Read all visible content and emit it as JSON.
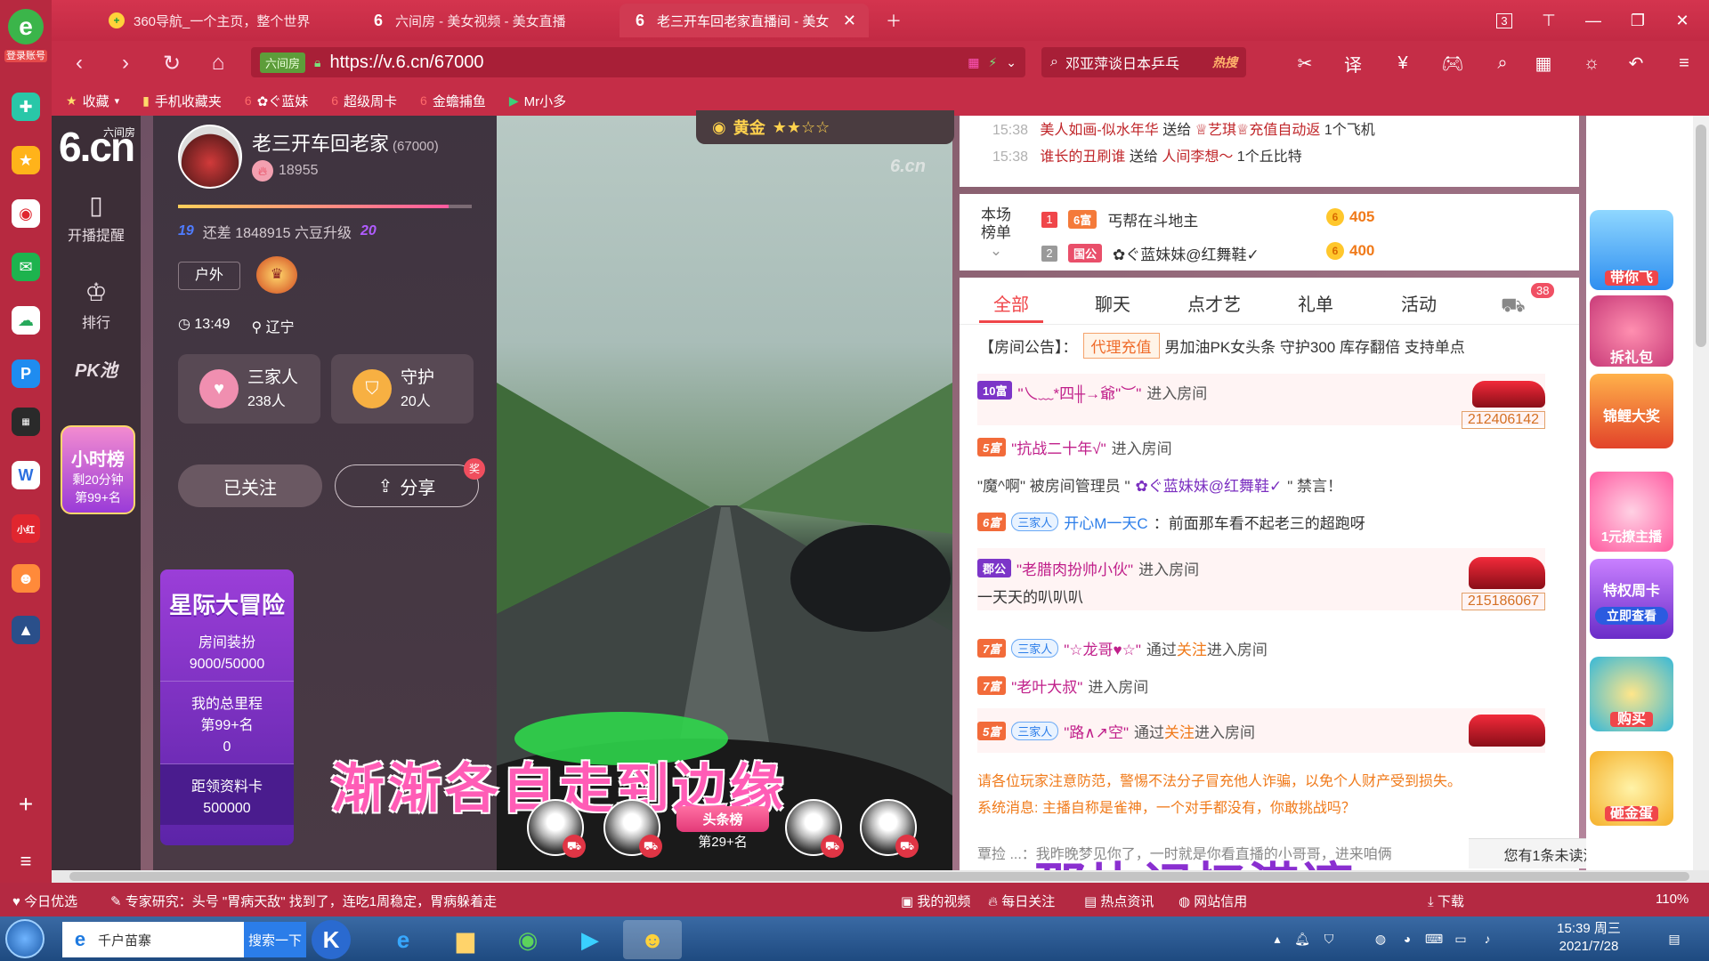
{
  "browser": {
    "account_label": "登录账号",
    "tabs": [
      {
        "label": "360导航_一个主页，整个世界"
      },
      {
        "label": "六间房 - 美女视频 - 美女直播"
      },
      {
        "label": "老三开车回老家直播间 - 美女"
      }
    ],
    "tab_count": "3",
    "url": "https://v.6.cn/67000",
    "site_badge": "六间房",
    "search_query": "邓亚萍谈日本乒乓",
    "search_hot": "热搜",
    "bookmarks": [
      {
        "label": "收藏"
      },
      {
        "label": "手机收藏夹"
      },
      {
        "label": "✿ぐ蓝妹"
      },
      {
        "label": "超级周卡"
      },
      {
        "label": "金蟾捕鱼"
      },
      {
        "label": "Mr小多"
      }
    ]
  },
  "site_nav": {
    "brand_big": "6.cn",
    "brand_small": "六间房",
    "items": [
      {
        "label": "开播提醒"
      },
      {
        "label": "排行"
      },
      {
        "label": "PK池"
      }
    ],
    "hour_rank": {
      "title": "小时榜",
      "remain": "剩20分钟",
      "rank": "第99+名"
    }
  },
  "host": {
    "name": "老三开车回老家",
    "room_id": "(67000)",
    "fans": "18955",
    "level_left": "19",
    "level_text": "还差 1848915 六豆升级",
    "level_right": "20",
    "level_progress": 0.92,
    "tag": "户外",
    "time": "13:49",
    "location": "辽宁",
    "family": {
      "label": "三家人",
      "count": "238人"
    },
    "guard": {
      "label": "守护",
      "count": "20人"
    },
    "follow_label": "已关注",
    "share_label": "分享",
    "share_badge": "奖"
  },
  "event": {
    "title": "星际大冒险",
    "sections": [
      {
        "label": "房间装扮",
        "value": "9000/50000"
      },
      {
        "label": "我的总里程",
        "value": "第99+名",
        "extra": "0"
      },
      {
        "label": "距领资料卡",
        "value": "500000"
      }
    ]
  },
  "video": {
    "badge": "黄金",
    "logo": "6.cn",
    "subtitle": "渐渐各自走到边缘",
    "top_fan_label": "头条榜",
    "top_fan_rank": "第29+名"
  },
  "gift_log": [
    {
      "time": "15:38",
      "from": "美人如画-似水年华",
      "verb": "送给",
      "to": "♕艺琪♕充值自动返",
      "gift": "1个飞机"
    },
    {
      "time": "15:38",
      "from": "谁长的丑刷谁",
      "verb": "送给",
      "to": "人间李想～",
      "gift": "1个丘比特"
    }
  ],
  "rank": {
    "title_line1": "本场",
    "title_line2": "榜单",
    "rows": [
      {
        "no": "1",
        "badge": "6富",
        "name": "丐帮在斗地主",
        "value": "405"
      },
      {
        "no": "2",
        "badge": "国公",
        "name": "✿ぐ蓝妹妹@红舞鞋✓",
        "value": "400"
      }
    ]
  },
  "chat": {
    "tabs": [
      {
        "label": "全部"
      },
      {
        "label": "聊天"
      },
      {
        "label": "点才艺"
      },
      {
        "label": "礼单"
      },
      {
        "label": "活动"
      }
    ],
    "car_count": "38",
    "announce_prefix": "【房间公告】：",
    "announce_agent": "代理充值",
    "announce_text": "男加油PK女头条 守护300 库存翻倍 支持单点",
    "messages": [
      {
        "badge": "10富",
        "name": "\"乀﹏*四╫→爺\"︶\"",
        "action": "进入房间",
        "car_id": "212406142"
      },
      {
        "badge": "5富",
        "name": "\"抗战二十年√\"",
        "action": "进入房间"
      },
      {
        "text1": "\"魔^啊\" 被房间管理员 \"",
        "name": "✿ぐ蓝妹妹@红舞鞋✓",
        "text2": "\" 禁言！"
      },
      {
        "badge": "6富",
        "family": "三家人",
        "name": "开心M一天C",
        "text": "：前面那车看不起老三的超跑呀"
      },
      {
        "badge": "郡公",
        "name": "\"老腊肉扮帅小伙\"",
        "action": "进入房间",
        "line2": "一天天的叭叭叭",
        "car_id": "215186067"
      },
      {
        "badge": "7富",
        "family": "三家人",
        "name": "\"☆龙哥♥☆\"",
        "via": "通过",
        "hl": "关注",
        "action": "进入房间"
      },
      {
        "badge": "7富",
        "name": "\"老叶大叔\"",
        "action": "进入房间"
      },
      {
        "badge": "5富",
        "family": "三家人",
        "name": "\"路∧↗空\"",
        "via": "通过",
        "hl": "关注",
        "action": "进入房间"
      }
    ],
    "warning": "请各位玩家注意防范，警惕不法分子冒充他人诈骗，以免个人财产受到损失。",
    "system": "系统消息: 主播自称是雀神，一个对手都没有，你敢挑战吗？",
    "last": "覃捡 ...：我昨晚梦见你了，一时就是你看直播的小哥哥，进来咱俩",
    "unread": "您有1条未读消息"
  },
  "promo": [
    {
      "label": "带你飞"
    },
    {
      "label": "拆礼包"
    },
    {
      "label": "锦鲤大奖"
    },
    {
      "label": "1元撩主播"
    },
    {
      "label": "特权周卡"
    },
    {
      "label": "立即查看"
    },
    {
      "label": "购买"
    },
    {
      "label": "砸金蛋"
    }
  ],
  "overlay_watermark": "那片记忆港湾",
  "statusbar": {
    "left": "今日优选",
    "news": "专家研究：头号 \"胃病天敌\" 找到了，连吃1周稳定，胃病躲着走",
    "items": [
      {
        "label": "我的视频"
      },
      {
        "label": "每日关注"
      },
      {
        "label": "热点资讯"
      },
      {
        "label": "网站信用"
      },
      {
        "label": "下载"
      }
    ],
    "zoom": "110%"
  },
  "taskbar": {
    "search_text": "千户苗寨",
    "search_btn": "搜索一下",
    "time": "15:39 周三",
    "date": "2021/7/28"
  }
}
